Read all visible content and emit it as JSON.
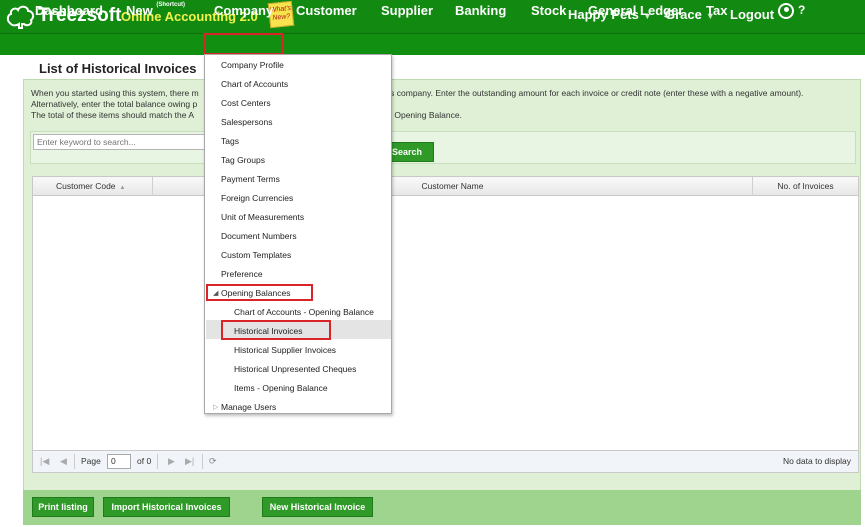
{
  "app": {
    "brand": "Treezsoft",
    "subtitle": "Online Accounting 2.0",
    "whats_new": "What's New?",
    "company_name": "Happy Pets",
    "user": "Grace",
    "logout": "Logout",
    "help": "?"
  },
  "nav": {
    "dashboard": "Dashboard",
    "new": "New",
    "new_shortcut": "(Shortcut)",
    "company": "Company",
    "customer": "Customer",
    "supplier": "Supplier",
    "banking": "Banking",
    "stock": "Stock",
    "general_ledger": "General Ledger",
    "tax": "Tax"
  },
  "page": {
    "title": "List of Historical Invoices",
    "intro_1": "When you started using this system, there m",
    "intro_1b": "to this company. Enter the outstanding amount for each invoice or credit note (enter these with a negative amount).",
    "intro_2": "Alternatively, enter the total balance owing p",
    "intro_3": "The total of these items should match the A",
    "intro_3b": "ounts - Opening Balance.",
    "search_placeholder": "Enter keyword to search...",
    "search_button": "Search"
  },
  "grid": {
    "columns": [
      "Customer Code",
      "Customer Name",
      "No. of Invoices"
    ],
    "rows": [],
    "pager": {
      "page_label": "Page",
      "page_value": "0",
      "of_label": "of 0",
      "empty_msg": "No data to display"
    }
  },
  "buttons": {
    "print_listing": "Print listing",
    "import": "Import Historical Invoices",
    "new_invoice": "New Historical Invoice"
  },
  "menu": {
    "items": [
      "Company Profile",
      "Chart of Accounts",
      "Cost Centers",
      "Salespersons",
      "Tags",
      "Tag Groups",
      "Payment Terms",
      "Foreign Currencies",
      "Unit of Measurements",
      "Document Numbers",
      "Custom Templates",
      "Preference"
    ],
    "opening_balances": "Opening Balances",
    "opening_sub": [
      "Chart of Accounts - Opening Balance",
      "Historical Invoices",
      "Historical Supplier Invoices",
      "Historical Unpresented Cheques",
      "Items - Opening Balance"
    ],
    "manage_users": "Manage Users"
  },
  "colors": {
    "topbar": "#128a12",
    "accent_yellow": "#f2f24a",
    "button_green": "#2f9a28",
    "panel_bg": "#dff0d6",
    "highlight_red": "#d9252a"
  }
}
